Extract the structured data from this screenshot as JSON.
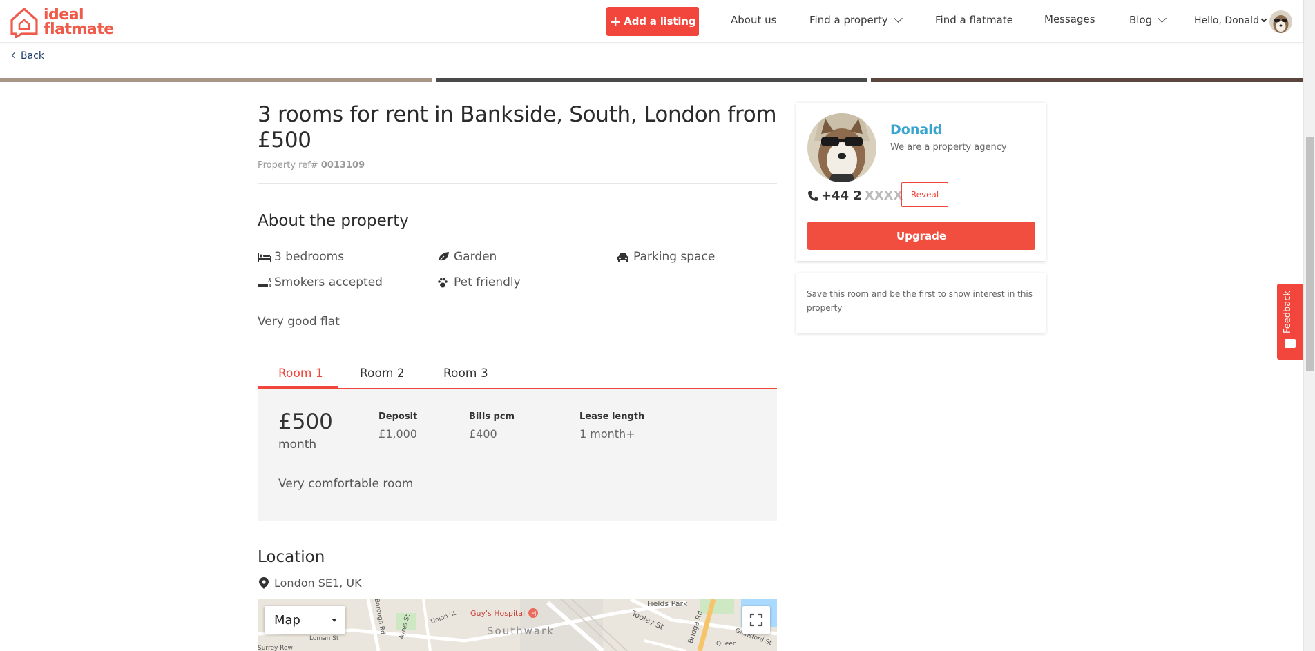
{
  "header": {
    "logo_line1": "ideal",
    "logo_line2": "flatmate",
    "add_listing": "Add a listing",
    "nav": {
      "about": "About us",
      "find_property": "Find a property",
      "find_flatmate": "Find a flatmate",
      "messages": "Messages",
      "blog": "Blog",
      "greeting": "Hello, Donald"
    },
    "brand_color": "#f2453b"
  },
  "back_label": "Back",
  "listing": {
    "title": "3 rooms for rent in Bankside, South, London from £500",
    "ref_label": "Property ref#",
    "ref_value": "0013109",
    "about_heading": "About the property",
    "features": {
      "bedrooms": "3 bedrooms",
      "garden": "Garden",
      "parking": "Parking space",
      "smokers": "Smokers accepted",
      "pets": "Pet friendly"
    },
    "description": "Very good flat"
  },
  "rooms": {
    "tabs": [
      "Room 1",
      "Room 2",
      "Room 3"
    ],
    "active": {
      "price": "£500",
      "period": "month",
      "deposit_label": "Deposit",
      "deposit_value": "£1,000",
      "bills_label": "Bills pcm",
      "bills_value": "£400",
      "lease_label": "Lease length",
      "lease_value": "1 month+",
      "description": "Very comfortable room"
    }
  },
  "location": {
    "heading": "Location",
    "address": "London SE1, UK",
    "map_type": "Map",
    "labels": [
      "Fields Park",
      "Guy's Hospital",
      "Southwark",
      "Tooley St",
      "Loman St",
      "Union St",
      "Ayres St",
      "Borough Rd",
      "Queen",
      "Gainsford St",
      "Surrey Row",
      "Bridge Rd"
    ]
  },
  "agent": {
    "name": "Donald",
    "tagline": "We are a property agency",
    "phone_prefix": "+44 2",
    "phone_mask": "XXXX",
    "reveal": "Reveal",
    "upgrade": "Upgrade"
  },
  "save_note": "Save this room and be the first to show interest in this property",
  "feedback": "Feedback"
}
